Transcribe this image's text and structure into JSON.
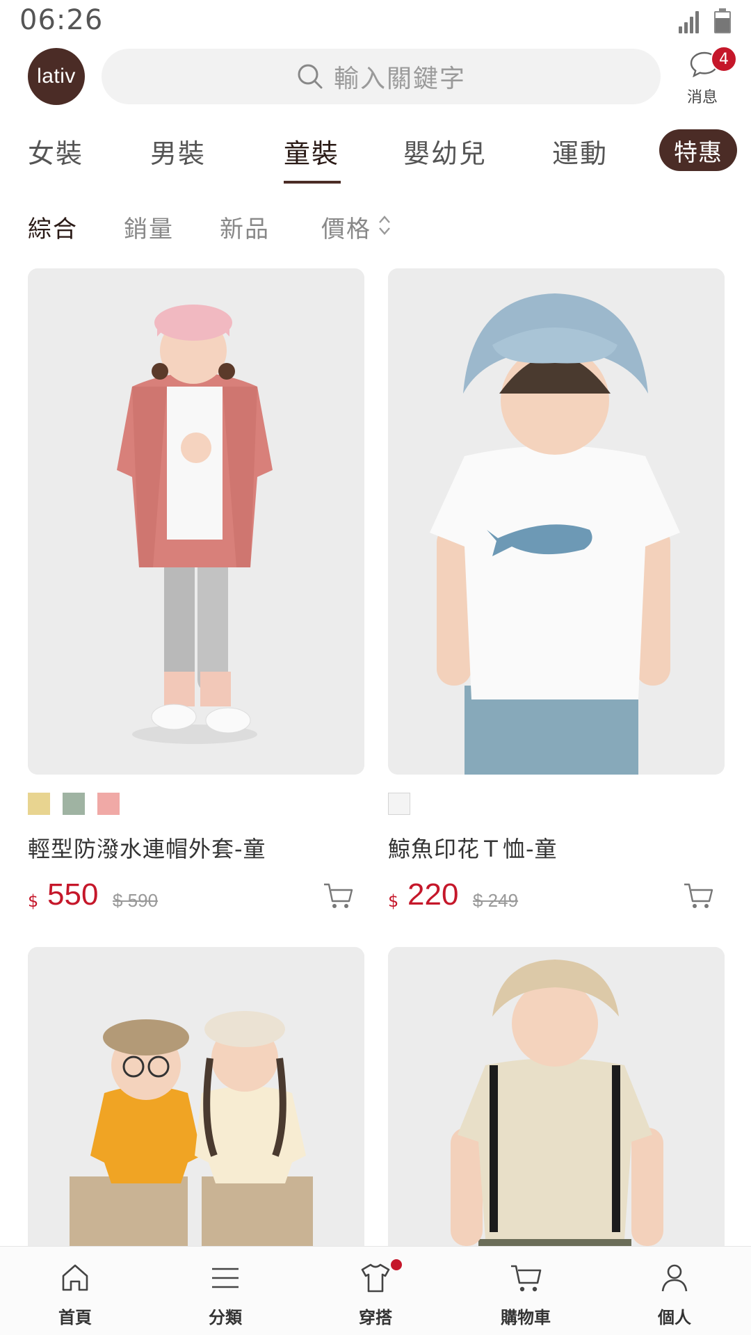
{
  "status_bar": {
    "time": "06:26"
  },
  "header": {
    "logo_text": "lativ",
    "search_placeholder": "輸入關鍵字",
    "messages": {
      "label": "消息",
      "badge_count": "4"
    }
  },
  "category_tabs": [
    {
      "label": "女裝",
      "active": false
    },
    {
      "label": "男裝",
      "active": false
    },
    {
      "label": "童裝",
      "active": true
    },
    {
      "label": "嬰幼兒",
      "active": false
    },
    {
      "label": "運動",
      "active": false
    },
    {
      "label": "特惠",
      "active": false,
      "style": "pill"
    }
  ],
  "sort_options": [
    {
      "label": "綜合",
      "active": true
    },
    {
      "label": "銷量",
      "active": false
    },
    {
      "label": "新品",
      "active": false
    },
    {
      "label": "價格",
      "active": false,
      "icon": "sort-arrows-icon"
    }
  ],
  "products": [
    {
      "name": "輕型防潑水連帽外套-童",
      "currency": "$",
      "price": "550",
      "original_price": "$ 590",
      "swatches": [
        "#e8d490",
        "#9fb3a2",
        "#f0a9a6"
      ],
      "image": "girl-in-pink-hooded-jacket"
    },
    {
      "name": "鯨魚印花Ｔ恤-童",
      "currency": "$",
      "price": "220",
      "original_price": "$ 249",
      "swatches": [
        "#f4f4f4"
      ],
      "image": "boy-in-whale-print-tee-and-bucket-hat"
    },
    {
      "image": "two-kids-in-garfield-tees"
    },
    {
      "image": "boy-in-beige-tee-with-backpack"
    }
  ],
  "bottom_nav": [
    {
      "label": "首頁",
      "icon": "home-icon"
    },
    {
      "label": "分類",
      "icon": "menu-icon"
    },
    {
      "label": "穿搭",
      "icon": "shirt-icon",
      "dot": true
    },
    {
      "label": "購物車",
      "icon": "cart-icon"
    },
    {
      "label": "個人",
      "icon": "person-icon"
    }
  ],
  "colors": {
    "brand": "#4b2c26",
    "price_red": "#c5172a"
  }
}
